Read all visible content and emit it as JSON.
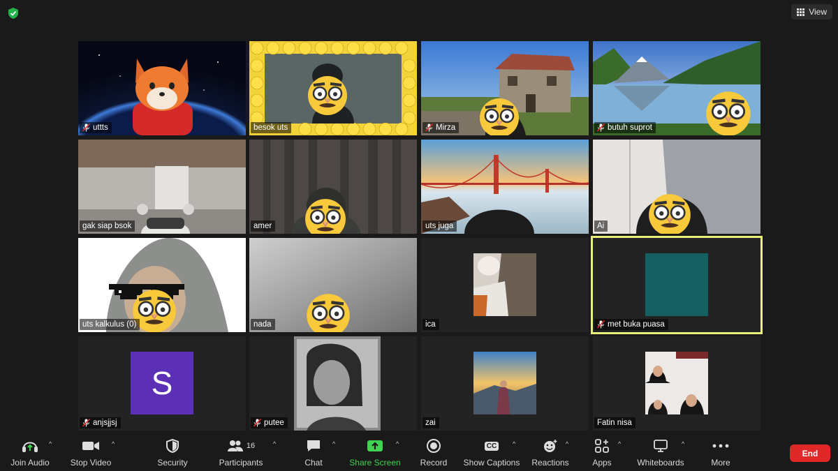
{
  "top": {
    "view_label": "View"
  },
  "tiles": [
    {
      "name": "uttts",
      "muted": true
    },
    {
      "name": "besok uts",
      "muted": false
    },
    {
      "name": "Mirza",
      "muted": true
    },
    {
      "name": "butuh suprot",
      "muted": true
    },
    {
      "name": "gak siap bsok",
      "muted": false
    },
    {
      "name": "amer",
      "muted": false
    },
    {
      "name": "uts juga",
      "muted": false
    },
    {
      "name": "Ai",
      "muted": false
    },
    {
      "name": "uts kalkulus (0)",
      "muted": false
    },
    {
      "name": "nada",
      "muted": false
    },
    {
      "name": "ica",
      "muted": false
    },
    {
      "name": "met buka puasa",
      "muted": true,
      "active_speaker": true
    },
    {
      "name": "anjsjjsj",
      "muted": true,
      "avatar_letter": "S"
    },
    {
      "name": "putee",
      "muted": true
    },
    {
      "name": "zai",
      "muted": false
    },
    {
      "name": "Fatin nisa",
      "muted": false
    }
  ],
  "toolbar": {
    "join_audio": "Join Audio",
    "stop_video": "Stop Video",
    "security": "Security",
    "participants": "Participants",
    "participants_count": "16",
    "chat": "Chat",
    "share_screen": "Share Screen",
    "record": "Record",
    "show_captions": "Show Captions",
    "captions_icon_text": "CC",
    "reactions": "Reactions",
    "apps": "Apps",
    "whiteboards": "Whiteboards",
    "more": "More",
    "end": "End"
  },
  "colors": {
    "active_speaker_border": "#e8f07a",
    "share_green": "#3fd34f",
    "end_red": "#e02828",
    "avatar_purple": "#5c2fb7",
    "teal_avatar": "#145f62"
  }
}
